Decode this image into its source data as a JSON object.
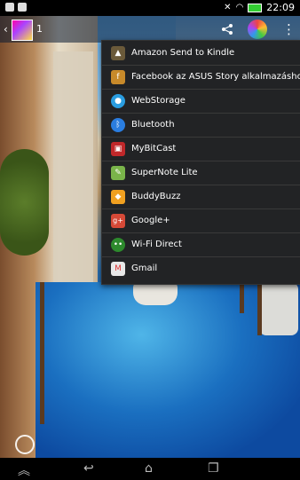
{
  "status_bar": {
    "time": "22:09"
  },
  "action_bar": {
    "back_glyph": "‹",
    "selected_count": "1",
    "overflow_glyph": "⋮"
  },
  "share_menu": {
    "items": [
      {
        "label": "Amazon Send to Kindle",
        "icon": "kindle-icon",
        "color": "#6b5a3a"
      },
      {
        "label": "Facebook az ASUS Story alkalmazáshoz",
        "icon": "asus-story-icon",
        "color": "#c88a2a"
      },
      {
        "label": "WebStorage",
        "icon": "webstorage-icon",
        "color": "#2a9de0"
      },
      {
        "label": "Bluetooth",
        "icon": "bluetooth-icon",
        "color": "#2a7de0"
      },
      {
        "label": "MyBitCast",
        "icon": "mybitcast-icon",
        "color": "#c0282a"
      },
      {
        "label": "SuperNote Lite",
        "icon": "supernote-icon",
        "color": "#7ab44a"
      },
      {
        "label": "BuddyBuzz",
        "icon": "buddybuzz-icon",
        "color": "#f0a020"
      },
      {
        "label": "Google+",
        "icon": "google-plus-icon",
        "color": "#d64937"
      },
      {
        "label": "Wi-Fi Direct",
        "icon": "wifi-direct-icon",
        "color": "#2d8a2d"
      },
      {
        "label": "Gmail",
        "icon": "gmail-icon",
        "color": "#e8e8e8"
      }
    ]
  },
  "nav_bar": {
    "back": "back-icon",
    "home": "home-icon",
    "recents": "recents-icon",
    "up": "up-icon"
  }
}
